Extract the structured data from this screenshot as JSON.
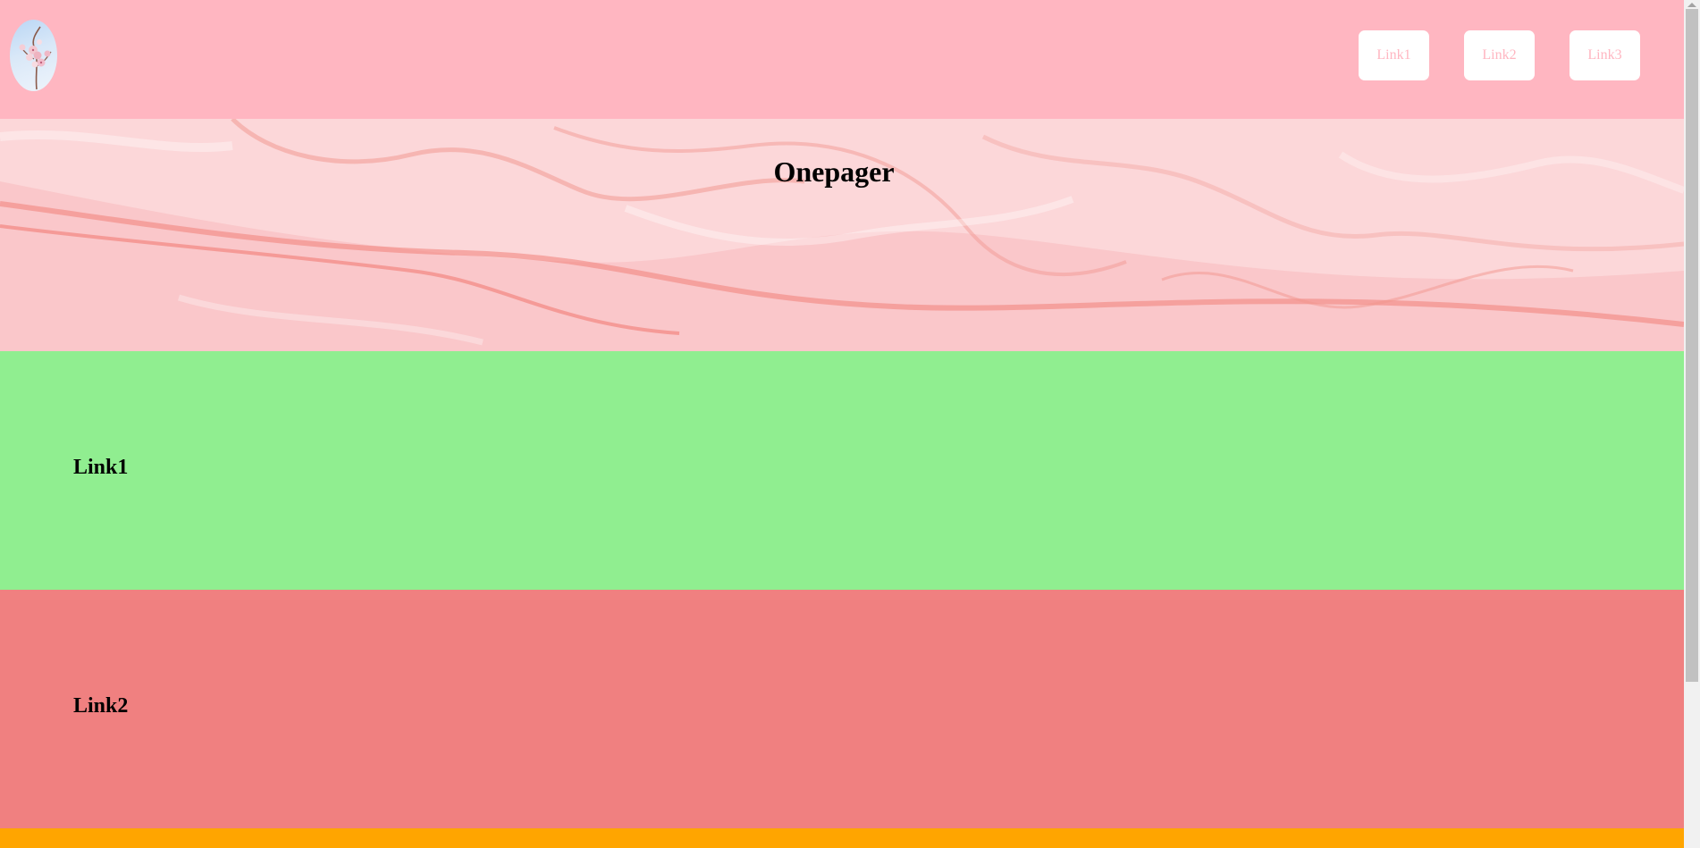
{
  "header": {
    "background": "#ffb6c1",
    "logo_icon": "cherry-blossom-logo",
    "nav": [
      {
        "label": "Link1"
      },
      {
        "label": "Link2"
      },
      {
        "label": "Link3"
      }
    ]
  },
  "hero": {
    "title": "Onepager",
    "background_image": "pink-marble-texture"
  },
  "sections": [
    {
      "title": "Link1",
      "background": "#90ee90"
    },
    {
      "title": "Link2",
      "background": "#f08080"
    },
    {
      "background": "#ffa500"
    }
  ]
}
